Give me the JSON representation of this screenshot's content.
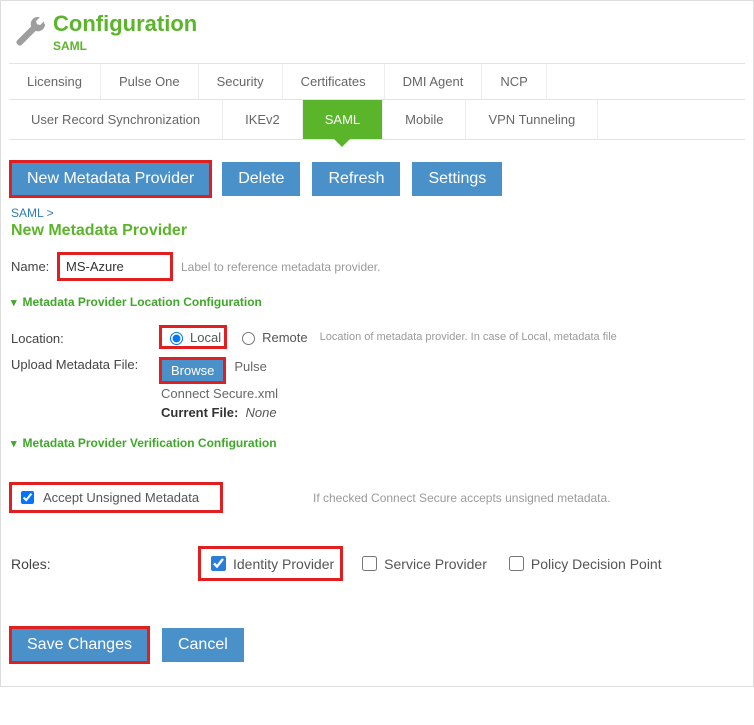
{
  "header": {
    "title": "Configuration",
    "subtitle": "SAML"
  },
  "tabs_row1": [
    "Licensing",
    "Pulse One",
    "Security",
    "Certificates",
    "DMI Agent",
    "NCP"
  ],
  "tabs_row2": [
    "User Record Synchronization",
    "IKEv2",
    "SAML",
    "Mobile",
    "VPN Tunneling"
  ],
  "active_tab": "SAML",
  "toolbar": {
    "new_provider": "New Metadata Provider",
    "delete": "Delete",
    "refresh": "Refresh",
    "settings": "Settings"
  },
  "breadcrumb": "SAML >",
  "form": {
    "title": "New Metadata Provider",
    "name_label": "Name:",
    "name_value": "MS-Azure",
    "name_hint": "Label to reference metadata provider.",
    "section_location": "Metadata Provider Location Configuration",
    "location_label": "Location:",
    "location_local": "Local",
    "location_remote": "Remote",
    "location_hint": "Location of metadata provider. In case of Local, metadata file",
    "upload_label": "Upload Metadata File:",
    "browse": "Browse",
    "file_side": "Pulse",
    "file_name": "Connect Secure.xml",
    "current_file_label": "Current File:",
    "current_file_value": "None",
    "section_verify": "Metadata Provider Verification Configuration",
    "accept_unsigned": "Accept Unsigned Metadata",
    "accept_hint": "If checked Connect Secure accepts unsigned metadata.",
    "roles_label": "Roles:",
    "role_idp": "Identity Provider",
    "role_sp": "Service Provider",
    "role_pdp": "Policy Decision Point"
  },
  "footer": {
    "save": "Save Changes",
    "cancel": "Cancel"
  }
}
